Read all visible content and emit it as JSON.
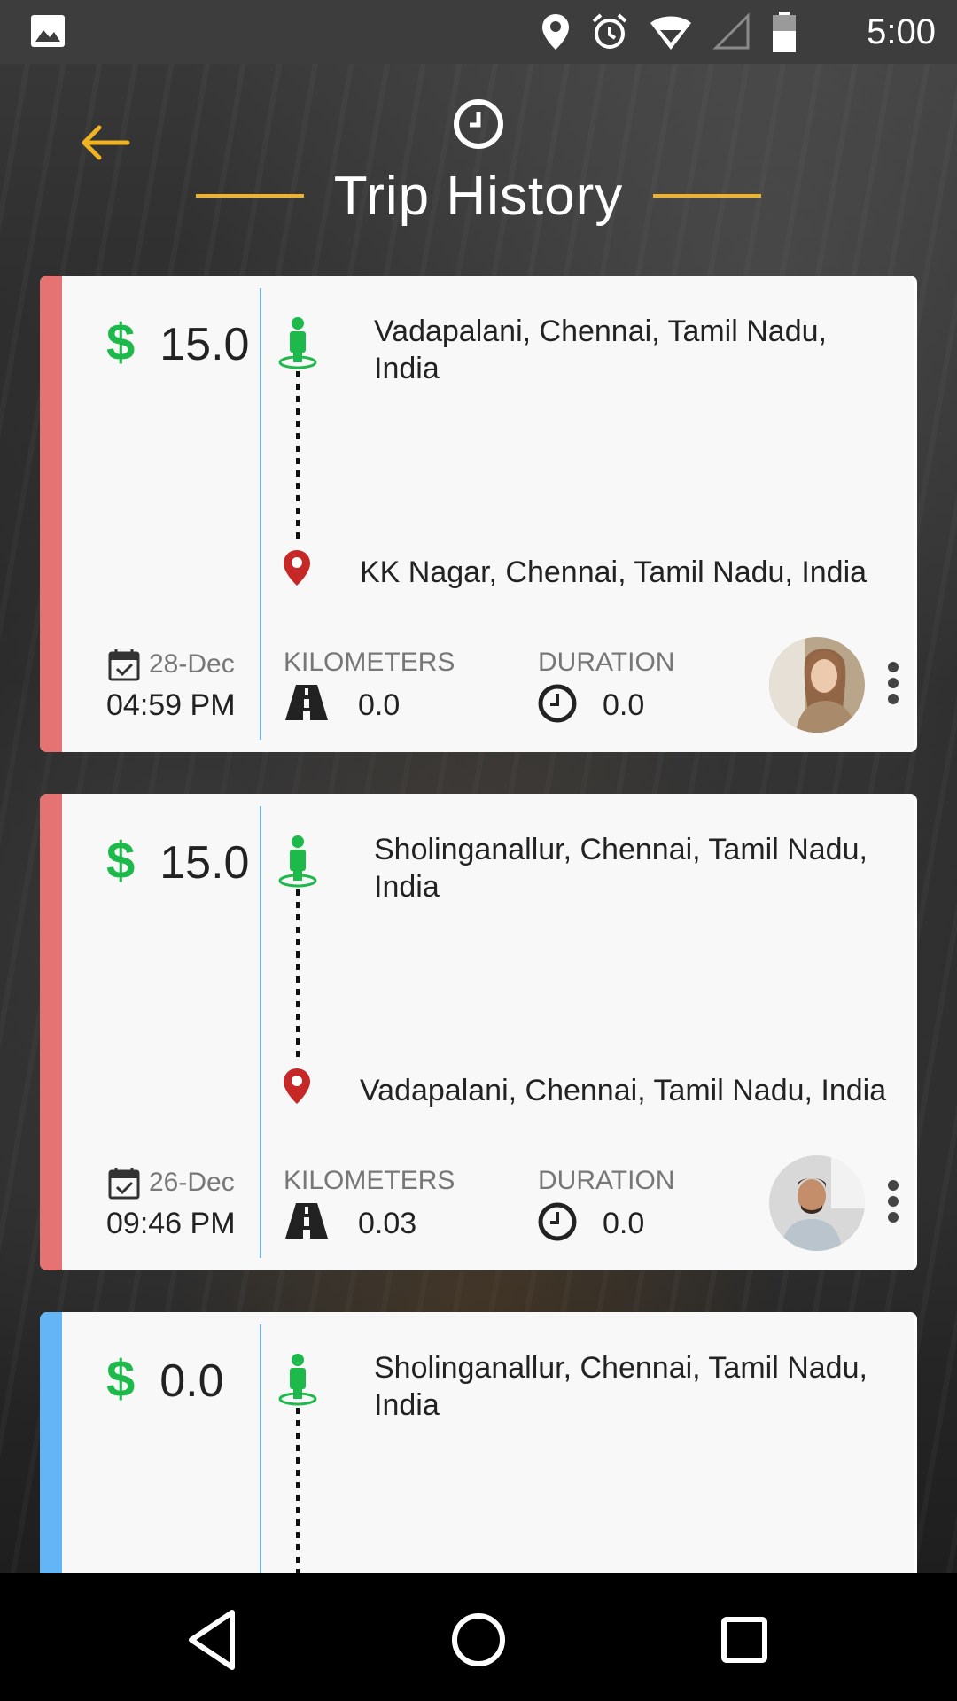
{
  "status_bar": {
    "time": "5:00",
    "icons": [
      "image-icon",
      "location-icon",
      "alarm-icon",
      "wifi-icon",
      "signal-icon",
      "battery-icon"
    ]
  },
  "header": {
    "title": "Trip History",
    "back_icon": "back-arrow-icon",
    "clock_icon": "clock-icon"
  },
  "colors": {
    "accent_line": "#f0b323",
    "fare_green": "#1db94a",
    "stripe_red": "#e57373",
    "stripe_blue": "#64b5f6",
    "divider_blue": "#6fb1e0",
    "drop_red": "#c62828"
  },
  "labels": {
    "kilometers": "KILOMETERS",
    "duration": "DURATION",
    "currency": "$"
  },
  "trips": [
    {
      "fare": "15.0",
      "pickup": "Vadapalani, Chennai, Tamil Nadu, India",
      "drop": "KK Nagar, Chennai, Tamil Nadu, India",
      "date": "28-Dec",
      "time": "04:59 PM",
      "kilometers": "0.0",
      "duration": "0.0",
      "status_color": "red"
    },
    {
      "fare": "15.0",
      "pickup": "Sholinganallur, Chennai, Tamil Nadu, India",
      "drop": "Vadapalani, Chennai, Tamil Nadu, India",
      "date": "26-Dec",
      "time": "09:46 PM",
      "kilometers": "0.03",
      "duration": "0.0",
      "status_color": "red"
    },
    {
      "fare": "0.0",
      "pickup": "Sholinganallur, Chennai, Tamil Nadu, India",
      "status_color": "blue"
    }
  ],
  "nav_bar": {
    "buttons": [
      "back-nav-icon",
      "home-nav-icon",
      "recents-nav-icon"
    ]
  }
}
